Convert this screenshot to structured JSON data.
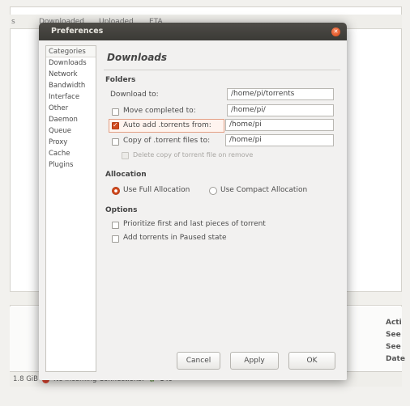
{
  "background": {
    "header_cols": [
      "s",
      "Downloaded",
      "Uploaded",
      "ETA"
    ],
    "side_labels": [
      "Acti",
      "See",
      "See",
      "Date"
    ],
    "status": {
      "size": "1.8 GiB",
      "connections": "No Incoming Connections!",
      "peers": "149"
    }
  },
  "dialog": {
    "title": "Preferences",
    "categories_header": "Categories",
    "categories": [
      "Downloads",
      "Network",
      "Bandwidth",
      "Interface",
      "Other",
      "Daemon",
      "Queue",
      "Proxy",
      "Cache",
      "Plugins"
    ],
    "section_title": "Downloads",
    "folders": {
      "label": "Folders",
      "download_to": {
        "label": "Download to:",
        "value": "/home/pi/torrents"
      },
      "move_completed": {
        "label": "Move completed to:",
        "value": "/home/pi/",
        "checked": false
      },
      "auto_add": {
        "label": "Auto add .torrents from:",
        "value": "/home/pi",
        "checked": true
      },
      "copy_torrent": {
        "label": "Copy of .torrent files to:",
        "value": "/home/pi",
        "checked": false
      },
      "delete_copy": {
        "label": "Delete copy of torrent file on remove",
        "checked": false
      }
    },
    "allocation": {
      "label": "Allocation",
      "full": "Use Full Allocation",
      "compact": "Use Compact Allocation",
      "selected": "full"
    },
    "options": {
      "label": "Options",
      "prioritize": {
        "label": "Prioritize first and last pieces of torrent",
        "checked": false
      },
      "paused": {
        "label": "Add torrents in Paused state",
        "checked": false
      }
    },
    "buttons": {
      "cancel": "Cancel",
      "apply": "Apply",
      "ok": "OK"
    }
  },
  "colors": {
    "accent": "#d04a1f",
    "titlebar": "#3b3a36",
    "close": "#dd4814"
  }
}
